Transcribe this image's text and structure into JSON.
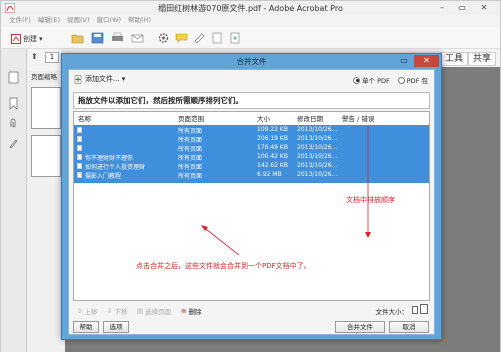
{
  "app": {
    "title": "榻田红树林游070原文件.pdf - Adobe Acrobat Pro",
    "menu": [
      "文件(F)",
      "编辑(E)",
      "视图(V)",
      "窗口(W)",
      "帮助(H)"
    ],
    "toolbar": {
      "create_label": "创建"
    },
    "right_tools": [
      "工具",
      "共享"
    ],
    "nav": {
      "page_number": "1"
    },
    "page_panel_label": "页面缩略"
  },
  "dialog": {
    "title": "合并文件",
    "add_files_label": "添加文件...",
    "radio_options": [
      {
        "label": "单个 PDF",
        "checked": true
      },
      {
        "label": "PDF 包",
        "checked": false
      }
    ],
    "instruction": "拖放文件以添加它们，然后按所需顺序排列它们。",
    "columns": [
      "名称",
      "页面范围",
      "大小",
      "修改日期",
      "警告 / 错误"
    ],
    "rows": [
      {
        "name": "",
        "range": "所有页面",
        "size": "109.22 KB",
        "date": "2013/10/26..."
      },
      {
        "name": "",
        "range": "所有页面",
        "size": "206.19 KB",
        "date": "2013/10/26..."
      },
      {
        "name": "",
        "range": "所有页面",
        "size": "170.49 KB",
        "date": "2013/10/26..."
      },
      {
        "name": "你不理财财不理你",
        "range": "所有页面",
        "size": "100.42 KB",
        "date": "2013/10/26..."
      },
      {
        "name": "如何进行个人投资理财",
        "range": "所有页面",
        "size": "142.62 KB",
        "date": "2013/10/26..."
      },
      {
        "name": "摄影入门教程",
        "range": "所有页面",
        "size": "6.92 MB",
        "date": "2013/10/26..."
      }
    ],
    "annotation_order": "文档中排放顺序",
    "annotation_merge": "点击合并之后，这些文件就会合并到一个PDF文档中了。",
    "tools": {
      "up": "上移",
      "down": "下移",
      "choose_pages": "选择页面",
      "delete": "删除"
    },
    "file_size_label": "文件大小：",
    "buttons": {
      "help": "帮助",
      "options": "选项",
      "merge": "合并文件",
      "cancel": "取消"
    }
  }
}
